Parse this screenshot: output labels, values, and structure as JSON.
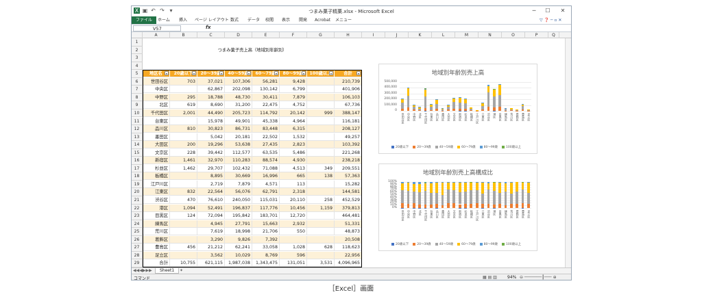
{
  "window": {
    "title": "つまみ菓子精菓.xlsx - Microsoft Excel",
    "name_box": "V57",
    "fx_label": "fx"
  },
  "ribbon_tabs": [
    "ファイル",
    "ホーム",
    "挿入",
    "ページ レイアウト",
    "数式",
    "データ",
    "校閲",
    "表示",
    "開発",
    "Acrobat",
    "メニュー"
  ],
  "columns": [
    "A",
    "B",
    "C",
    "D",
    "E",
    "F",
    "G",
    "H",
    "I",
    "J",
    "K",
    "L",
    "M",
    "N",
    "O",
    "P",
    "Q"
  ],
  "sheet": {
    "title": "つまみ菓子売上高（地域別年齢別）",
    "headers": [
      "地区名",
      "20歳以下",
      "20～39歳",
      "40～59歳",
      "60～79歳",
      "80～99歳",
      "100歳以上",
      "合計"
    ],
    "rows": [
      [
        "世田谷区",
        "703",
        "37,021",
        "107,306",
        "56,281",
        "9,428",
        "",
        "210,739"
      ],
      [
        "中央区",
        "",
        "62,867",
        "202,098",
        "130,142",
        "6,799",
        "",
        "401,906"
      ],
      [
        "中野区",
        "295",
        "18,788",
        "48,730",
        "30,411",
        "7,879",
        "",
        "106,103"
      ],
      [
        "北区",
        "619",
        "8,690",
        "31,200",
        "22,475",
        "4,752",
        "",
        "67,736"
      ],
      [
        "千代田区",
        "2,001",
        "44,490",
        "205,723",
        "114,792",
        "20,142",
        "999",
        "388,147"
      ],
      [
        "台東区",
        "",
        "15,978",
        "49,901",
        "45,338",
        "4,964",
        "",
        "116,181"
      ],
      [
        "品川区",
        "810",
        "30,823",
        "86,731",
        "83,448",
        "6,315",
        "",
        "208,127"
      ],
      [
        "墨田区",
        "",
        "5,042",
        "20,181",
        "22,502",
        "1,532",
        "",
        "49,257"
      ],
      [
        "大田区",
        "200",
        "19,296",
        "53,638",
        "27,435",
        "2,823",
        "",
        "103,392"
      ],
      [
        "文京区",
        "228",
        "39,442",
        "112,577",
        "63,535",
        "5,486",
        "",
        "221,268"
      ],
      [
        "新宿区",
        "1,461",
        "32,970",
        "110,283",
        "88,574",
        "4,930",
        "",
        "238,218"
      ],
      [
        "杉並区",
        "1,462",
        "29,707",
        "102,432",
        "71,088",
        "4,513",
        "349",
        "209,551"
      ],
      [
        "板橋区",
        "",
        "8,895",
        "30,669",
        "16,996",
        "665",
        "138",
        "57,363"
      ],
      [
        "江戸川区",
        "",
        "2,719",
        "7,879",
        "4,571",
        "113",
        "",
        "15,282"
      ],
      [
        "江東区",
        "832",
        "22,564",
        "56,076",
        "62,791",
        "2,318",
        "",
        "144,581"
      ],
      [
        "渋谷区",
        "470",
        "76,610",
        "240,050",
        "115,031",
        "20,110",
        "258",
        "452,529"
      ],
      [
        "港区",
        "1,094",
        "52,491",
        "196,837",
        "117,776",
        "10,456",
        "1,159",
        "379,813"
      ],
      [
        "目黒区",
        "124",
        "72,094",
        "195,842",
        "183,701",
        "12,720",
        "",
        "464,481"
      ],
      [
        "練馬区",
        "",
        "4,945",
        "27,791",
        "15,663",
        "2,932",
        "",
        "51,331"
      ],
      [
        "荒川区",
        "",
        "7,619",
        "18,998",
        "21,706",
        "550",
        "",
        "48,873"
      ],
      [
        "葛飾区",
        "",
        "3,290",
        "9,826",
        "7,392",
        "",
        "",
        "20,508"
      ],
      [
        "豊島区",
        "456",
        "21,212",
        "62,241",
        "33,058",
        "1,028",
        "628",
        "118,623"
      ],
      [
        "足立区",
        "",
        "3,562",
        "10,029",
        "8,769",
        "596",
        "",
        "22,956"
      ]
    ],
    "total": [
      "合計",
      "10,755",
      "621,115",
      "1,987,038",
      "1,343,475",
      "131,051",
      "3,531",
      "4,096,965"
    ]
  },
  "chart1": {
    "title": "地域別年齢別売上高",
    "yticks": [
      "500,000",
      "400,000",
      "300,000",
      "200,000",
      "100,000",
      "0"
    ]
  },
  "chart2": {
    "title": "地域別年齢別売上高構成比",
    "yticks": [
      "100%",
      "90%",
      "80%",
      "70%",
      "60%",
      "50%",
      "40%",
      "30%",
      "20%",
      "10%",
      "0%"
    ]
  },
  "chart_data": [
    {
      "type": "bar",
      "stacked": true,
      "title": "地域別年齢別売上高",
      "categories": [
        "世田谷区",
        "中央区",
        "中野区",
        "北区",
        "千代田区",
        "台東区",
        "品川区",
        "墨田区",
        "大田区",
        "文京区",
        "新宿区",
        "杉並区",
        "板橋区",
        "江戸川区",
        "江東区",
        "渋谷区",
        "港区",
        "目黒区",
        "練馬区",
        "荒川区",
        "葛飾区",
        "豊島区",
        "足立区"
      ],
      "ylim": [
        0,
        500000
      ],
      "legend": "bottom",
      "series": [
        {
          "name": "20歳以下",
          "color": "#4472c4",
          "values": [
            703,
            0,
            295,
            619,
            2001,
            0,
            810,
            0,
            200,
            228,
            1461,
            1462,
            0,
            0,
            832,
            470,
            1094,
            124,
            0,
            0,
            0,
            456,
            0
          ]
        },
        {
          "name": "20～39歳",
          "color": "#ed7d31",
          "values": [
            37021,
            62867,
            18788,
            8690,
            44490,
            15978,
            30823,
            5042,
            19296,
            39442,
            32970,
            29707,
            8895,
            2719,
            22564,
            76610,
            52491,
            72094,
            4945,
            7619,
            3290,
            21212,
            3562
          ]
        },
        {
          "name": "40～59歳",
          "color": "#a5a5a5",
          "values": [
            107306,
            202098,
            48730,
            31200,
            205723,
            49901,
            86731,
            20181,
            53638,
            112577,
            110283,
            102432,
            30669,
            7879,
            56076,
            240050,
            196837,
            195842,
            27791,
            18998,
            9826,
            62241,
            10029
          ]
        },
        {
          "name": "60～79歳",
          "color": "#ffc000",
          "values": [
            56281,
            130142,
            30411,
            22475,
            114792,
            45338,
            83448,
            22502,
            27435,
            63535,
            88574,
            71088,
            16996,
            4571,
            62791,
            115031,
            117776,
            183701,
            15663,
            21706,
            7392,
            33058,
            8769
          ]
        },
        {
          "name": "80～99歳",
          "color": "#5b9bd5",
          "values": [
            9428,
            6799,
            7879,
            4752,
            20142,
            4964,
            6315,
            1532,
            2823,
            5486,
            4930,
            4513,
            665,
            113,
            2318,
            20110,
            10456,
            12720,
            2932,
            550,
            0,
            1028,
            596
          ]
        },
        {
          "name": "100歳以上",
          "color": "#70ad47",
          "values": [
            0,
            0,
            0,
            0,
            999,
            0,
            0,
            0,
            0,
            0,
            0,
            349,
            138,
            0,
            0,
            258,
            1159,
            0,
            0,
            0,
            0,
            628,
            0
          ]
        }
      ]
    },
    {
      "type": "bar",
      "stacked": true,
      "percent": true,
      "title": "地域別年齢別売上高構成比",
      "categories": [
        "世田谷区",
        "中央区",
        "中野区",
        "北区",
        "千代田区",
        "台東区",
        "品川区",
        "墨田区",
        "大田区",
        "文京区",
        "新宿区",
        "杉並区",
        "板橋区",
        "江戸川区",
        "江東区",
        "渋谷区",
        "港区",
        "目黒区",
        "練馬区",
        "荒川区",
        "葛飾区",
        "豊島区",
        "足立区"
      ],
      "ylim": [
        0,
        100
      ],
      "legend": "bottom",
      "series_ref": "same as chart 1"
    }
  ],
  "sheet_tab": "Sheet1",
  "status": {
    "mode": "コマンド",
    "zoom": "94%"
  },
  "caption": "［Excel］画面"
}
